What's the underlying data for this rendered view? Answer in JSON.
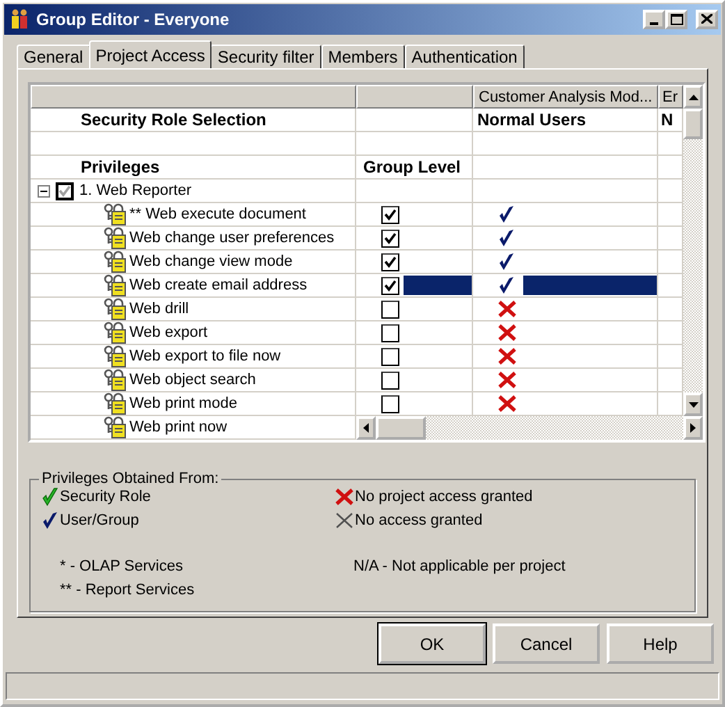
{
  "window": {
    "title": "Group Editor - Everyone"
  },
  "tabs": [
    {
      "label": "General",
      "selected": false
    },
    {
      "label": "Project Access",
      "selected": true
    },
    {
      "label": "Security filter",
      "selected": false
    },
    {
      "label": "Members",
      "selected": false
    },
    {
      "label": "Authentication",
      "selected": false
    }
  ],
  "grid": {
    "header": [
      "Customer Analysis Mod...",
      "Er"
    ],
    "role_row": {
      "label": "Security Role Selection",
      "values": [
        "Normal Users",
        "N"
      ]
    },
    "columns_row": {
      "label": "Privileges",
      "group_level": "Group Level"
    },
    "tree": {
      "label": "1. Web Reporter",
      "expanded": true,
      "checked": true,
      "children": [
        {
          "name": "** Web execute document",
          "checked": true,
          "kind": "user_group",
          "selected": false
        },
        {
          "name": "Web change user preferences",
          "checked": true,
          "kind": "user_group",
          "selected": false
        },
        {
          "name": "Web change view mode",
          "checked": true,
          "kind": "user_group",
          "selected": false
        },
        {
          "name": "Web create email address",
          "checked": true,
          "kind": "user_group",
          "selected": true
        },
        {
          "name": "Web drill",
          "checked": false,
          "kind": "no_project_access",
          "selected": false
        },
        {
          "name": "Web export",
          "checked": false,
          "kind": "no_project_access",
          "selected": false
        },
        {
          "name": "Web export to file now",
          "checked": false,
          "kind": "no_project_access",
          "selected": false
        },
        {
          "name": "Web object search",
          "checked": false,
          "kind": "no_project_access",
          "selected": false
        },
        {
          "name": "Web print mode",
          "checked": false,
          "kind": "no_project_access",
          "selected": false
        },
        {
          "name": "Web print now",
          "kind": "partial"
        }
      ]
    }
  },
  "legend": {
    "title": "Privileges Obtained From:",
    "items": [
      {
        "kind": "security_role",
        "label": "Security Role"
      },
      {
        "kind": "no_project_access",
        "label": "No project access granted"
      },
      {
        "kind": "user_group",
        "label": "User/Group"
      },
      {
        "kind": "no_access",
        "label": "No access granted"
      }
    ],
    "notes": [
      "* - OLAP Services",
      "N/A - Not applicable per project",
      "** - Report Services"
    ]
  },
  "buttons": [
    "OK",
    "Cancel",
    "Help"
  ]
}
